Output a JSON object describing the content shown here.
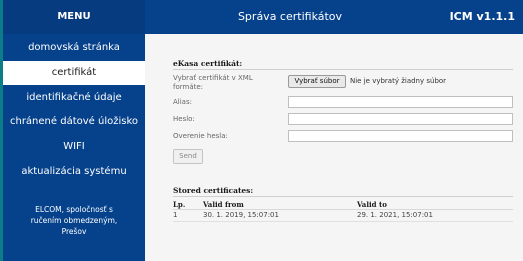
{
  "menu": {
    "title": "MENU",
    "items": [
      {
        "label": "domovská stránka"
      },
      {
        "label": "certifikát"
      },
      {
        "label": "identifikačné údaje"
      },
      {
        "label": "chránené dátové úložisko"
      },
      {
        "label": "WIFI"
      },
      {
        "label": "aktualizácia systému"
      }
    ],
    "footer": [
      "ELCOM, spoločnosť s",
      "ručením obmedzeným,",
      "Prešov"
    ]
  },
  "header": {
    "title": "Správa certifikátov",
    "version": "ICM v1.1.1"
  },
  "form": {
    "section_title": "eKasa certifikát:",
    "file_label_1": "Vybrať certifikát v XML",
    "file_label_2": "formáte:",
    "file_button": "Vybrať súbor",
    "file_status": "Nie je vybratý žiadny súbor",
    "alias_label": "Alias:",
    "alias_value": "",
    "password_label": "Heslo:",
    "password_value": "",
    "verify_label": "Overenie hesla:",
    "verify_value": "",
    "send_button": "Send"
  },
  "stored": {
    "section_title": "Stored certificates:",
    "columns": [
      "Lp.",
      "Valid from",
      "Valid to"
    ],
    "rows": [
      [
        "1",
        "30. 1. 2019, 15:07:01",
        "29. 1. 2021, 15:07:01"
      ]
    ]
  },
  "colors": {
    "sidebar": "#06428c",
    "accent_edge": "#0a7d87",
    "content_bg": "#f5f5f5"
  }
}
